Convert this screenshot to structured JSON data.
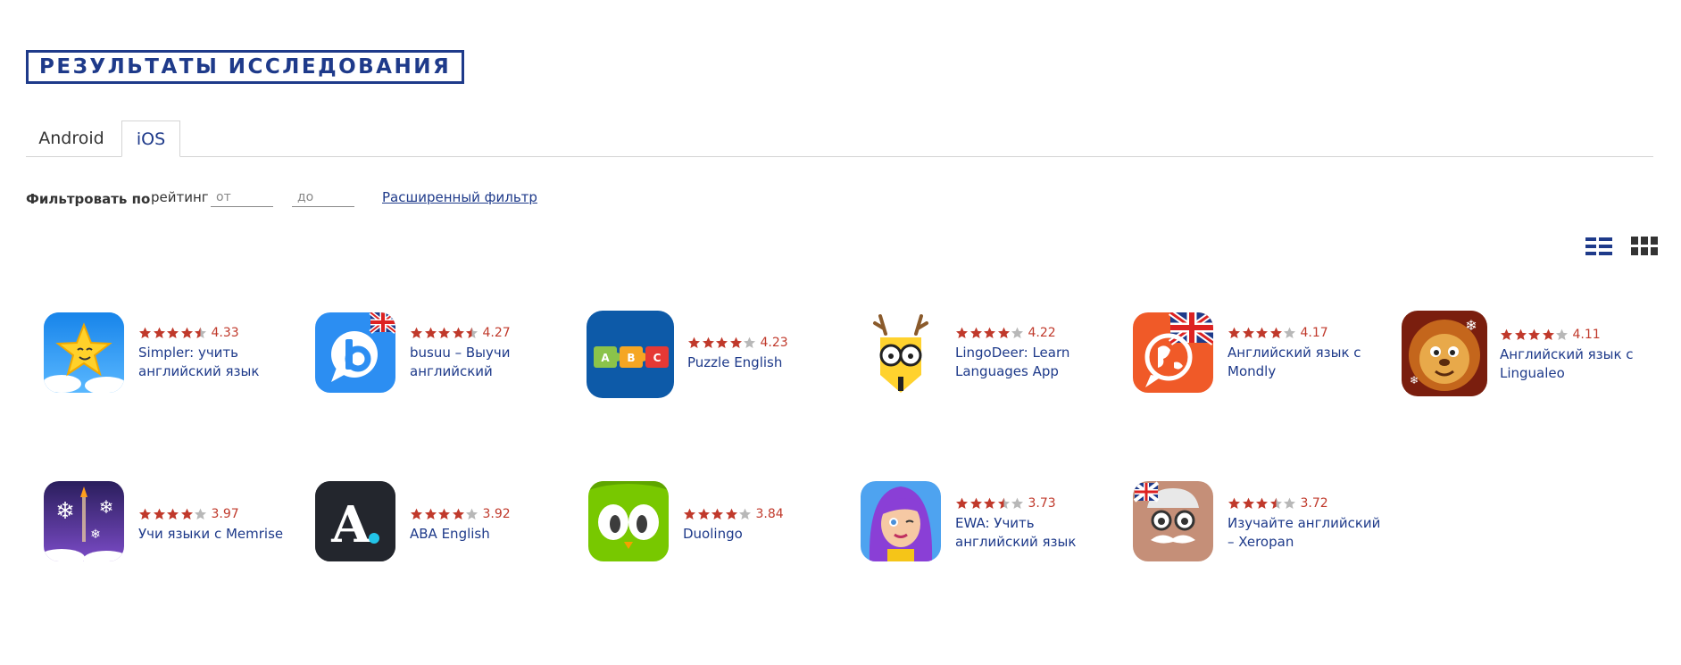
{
  "page": {
    "title": "РЕЗУЛЬТАТЫ ИССЛЕДОВАНИЯ"
  },
  "tabs": [
    {
      "label": "Android",
      "active": false
    },
    {
      "label": "iOS",
      "active": true
    }
  ],
  "filter": {
    "label": "Фильтровать по",
    "field": "рейтинг",
    "from_placeholder": "от",
    "to_placeholder": "до",
    "advanced_link": "Расширенный фильтр"
  },
  "view_toggle": {
    "list_icon": "list-view-icon",
    "grid_icon": "grid-view-icon"
  },
  "colors": {
    "accent": "#1e3a8a",
    "rating": "#c0392b",
    "star_empty": "#b8b8b8"
  },
  "apps": [
    {
      "name": "Simpler: учить английский язык",
      "rating": "4.33",
      "stars": 4.5,
      "icon": "star-face-icon"
    },
    {
      "name": "busuu – Выучи английский",
      "rating": "4.27",
      "stars": 4.5,
      "icon": "busuu-b-icon"
    },
    {
      "name": "Puzzle English",
      "rating": "4.23",
      "stars": 4,
      "icon": "abc-puzzle-icon"
    },
    {
      "name": "LingoDeer: Learn Languages App",
      "rating": "4.22",
      "stars": 4,
      "icon": "deer-glasses-icon"
    },
    {
      "name": "Английский язык с Mondly",
      "rating": "4.17",
      "stars": 4,
      "icon": "globe-speech-icon"
    },
    {
      "name": "Английский язык с Lingualeo",
      "rating": "4.11",
      "stars": 4,
      "icon": "lion-icon"
    },
    {
      "name": "Учи языки с Memrise",
      "rating": "3.97",
      "stars": 4,
      "icon": "snowflake-rocket-icon"
    },
    {
      "name": "ABA English",
      "rating": "3.92",
      "stars": 4,
      "icon": "aba-letter-icon"
    },
    {
      "name": "Duolingo",
      "rating": "3.84",
      "stars": 4,
      "icon": "owl-eyes-icon"
    },
    {
      "name": "EWA: Учить английский язык",
      "rating": "3.73",
      "stars": 3.5,
      "icon": "ewa-girl-icon"
    },
    {
      "name": "Изучайте английский – Xeropan",
      "rating": "3.72",
      "stars": 3.5,
      "icon": "professor-icon"
    }
  ]
}
